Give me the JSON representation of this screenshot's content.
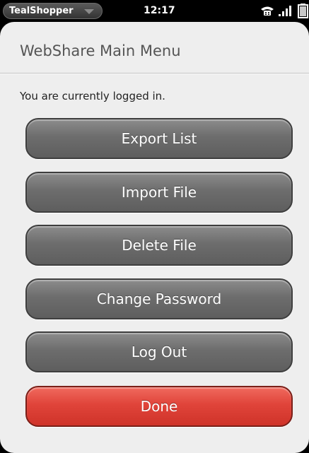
{
  "status_bar": {
    "app_name": "TealShopper",
    "time": "12:17",
    "icons": [
      "phone-icon",
      "signal-icon",
      "battery-icon"
    ]
  },
  "header": {
    "title": "WebShare Main Menu"
  },
  "main": {
    "login_status": "You are currently logged in.",
    "buttons": [
      {
        "label": "Export List",
        "style": "gray"
      },
      {
        "label": "Import File",
        "style": "gray"
      },
      {
        "label": "Delete File",
        "style": "gray"
      },
      {
        "label": "Change Password",
        "style": "gray"
      },
      {
        "label": "Log Out",
        "style": "gray"
      },
      {
        "label": "Done",
        "style": "red"
      }
    ]
  },
  "colors": {
    "card_background": "#eeeeee",
    "button_gray": "#6d6d6d",
    "button_red": "#e0443a",
    "title_text": "#555555"
  }
}
